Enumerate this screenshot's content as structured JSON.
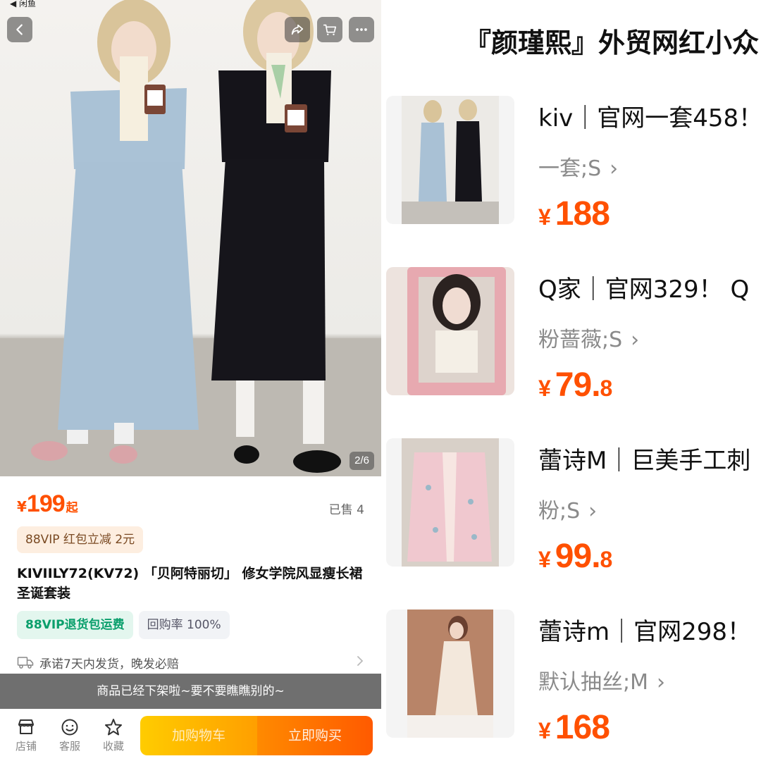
{
  "status_bar": {
    "back_app": "◀ 闲鱼"
  },
  "product": {
    "image_counter": "2/6",
    "price": {
      "currency": "¥",
      "amount": "199",
      "suffix": "起"
    },
    "sold": "已售 4",
    "vip_redpacket": "88VIP 红包立减 2元",
    "title": "KIVIILY72(KV72) 「贝阿特丽切」 修女学院风显瘦长裙圣诞套装",
    "tags": {
      "return_shipping": "88VIP退货包运费",
      "repurchase": "回购率 100%"
    },
    "shipping_promise": "承诺7天内发货，晚发必赔",
    "offshelf_notice": "商品已经下架啦~要不要瞧瞧别的~"
  },
  "bottom_bar": {
    "store": "店铺",
    "service": "客服",
    "favorite": "收藏",
    "add_to_cart": "加购物车",
    "buy_now": "立即购买"
  },
  "shop": {
    "title": "『颜瑾熙』外贸网红小众",
    "items": [
      {
        "name": "kiv｜官网一套458！",
        "sku": "一套;S",
        "arrow": "›",
        "currency": "¥",
        "price_int": "188",
        "price_dec": ""
      },
      {
        "name": "Q家｜官网329！ Q",
        "sku": "粉蔷薇;S",
        "arrow": "›",
        "currency": "¥",
        "price_int": "79.",
        "price_dec": "8"
      },
      {
        "name": "蕾诗M｜巨美手工刺",
        "sku": "粉;S",
        "arrow": "›",
        "currency": "¥",
        "price_int": "99.",
        "price_dec": "8"
      },
      {
        "name": "蕾诗m｜官网298！",
        "sku": "默认抽丝;M",
        "arrow": "›",
        "currency": "¥",
        "price_int": "168",
        "price_dec": ""
      }
    ]
  },
  "colors": {
    "accent_orange": "#ff5000",
    "vip_green": "#0a9f6c",
    "offshelf_gray": "#6f6f6f"
  },
  "icons": [
    "back-icon",
    "share-icon",
    "cart-icon",
    "more-icon",
    "truck-icon",
    "store-icon",
    "service-icon",
    "star-icon"
  ]
}
